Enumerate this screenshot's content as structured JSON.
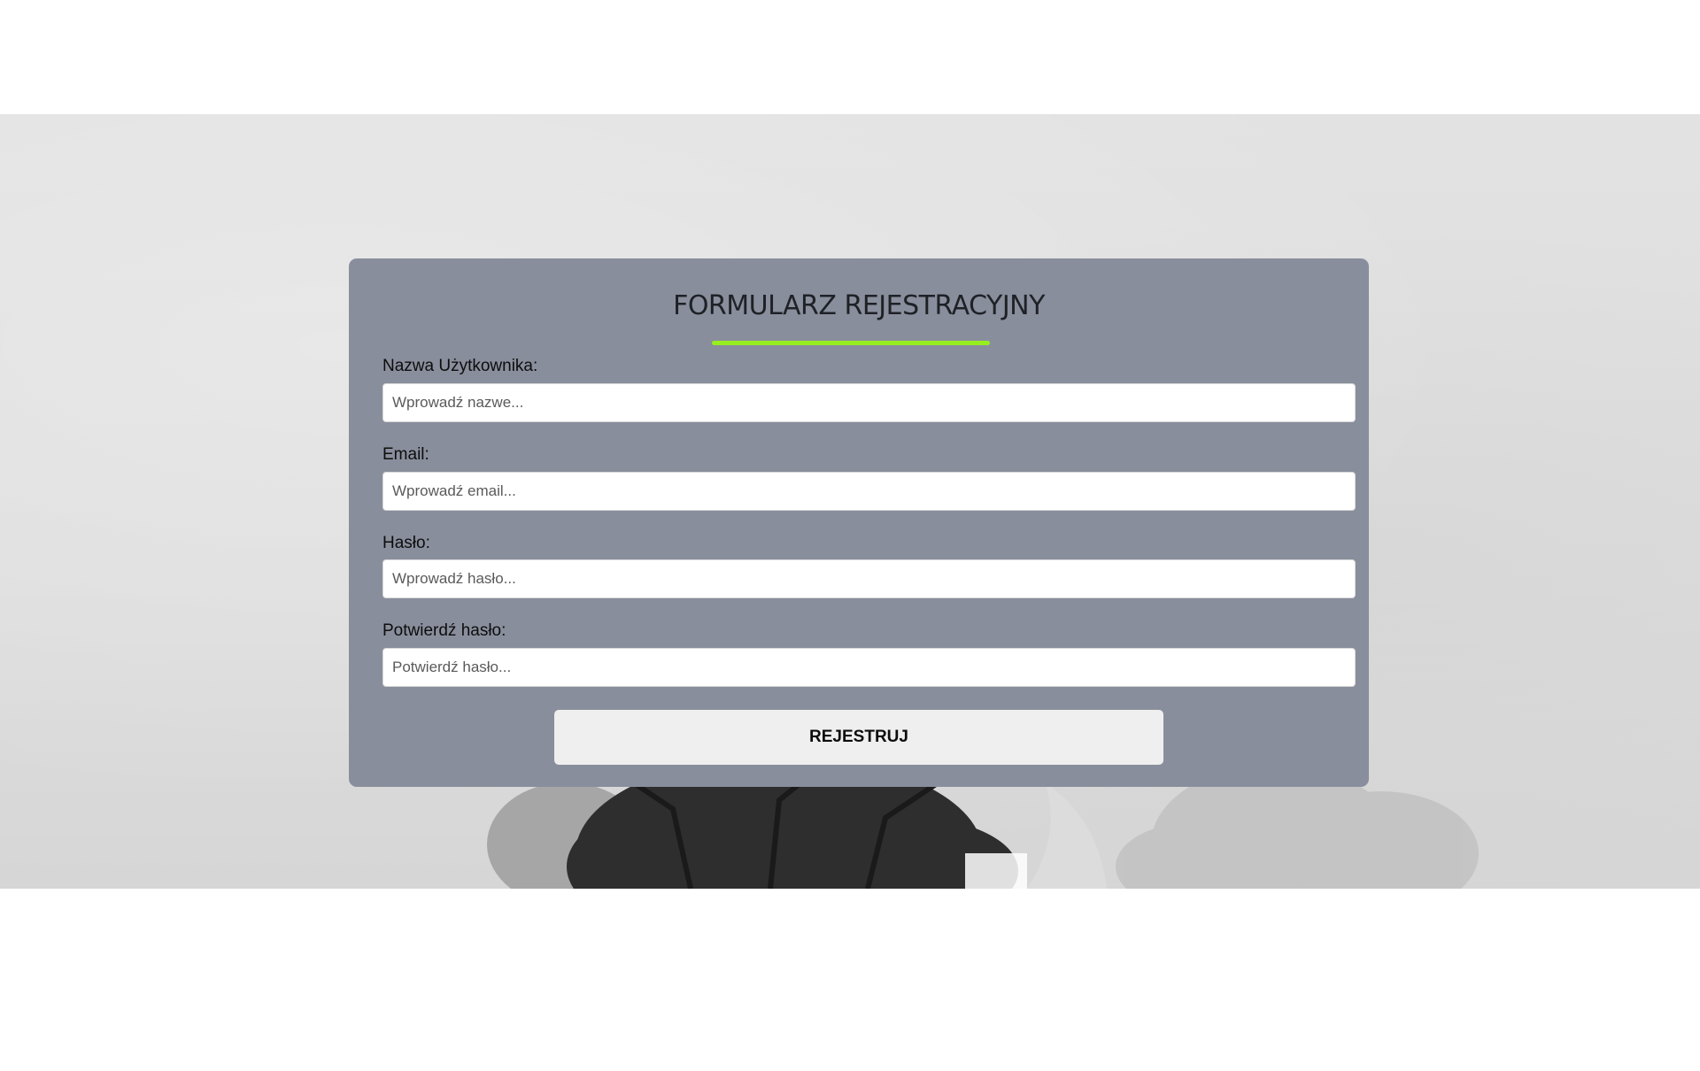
{
  "form": {
    "title": "FORMULARZ REJESTRACYJNY",
    "accent_color": "#97ee1f",
    "card_color": "#898e9c",
    "fields": [
      {
        "label": "Nazwa Użytkownika:",
        "placeholder": "Wprowadź nazwe...",
        "value": ""
      },
      {
        "label": "Email:",
        "placeholder": "Wprowadź email...",
        "value": ""
      },
      {
        "label": "Hasło:",
        "placeholder": "Wprowadź hasło...",
        "value": ""
      },
      {
        "label": "Potwierdź hasło:",
        "placeholder": "Potwierdź hasło...",
        "value": ""
      }
    ],
    "submit_label": "REJESTRUJ"
  }
}
